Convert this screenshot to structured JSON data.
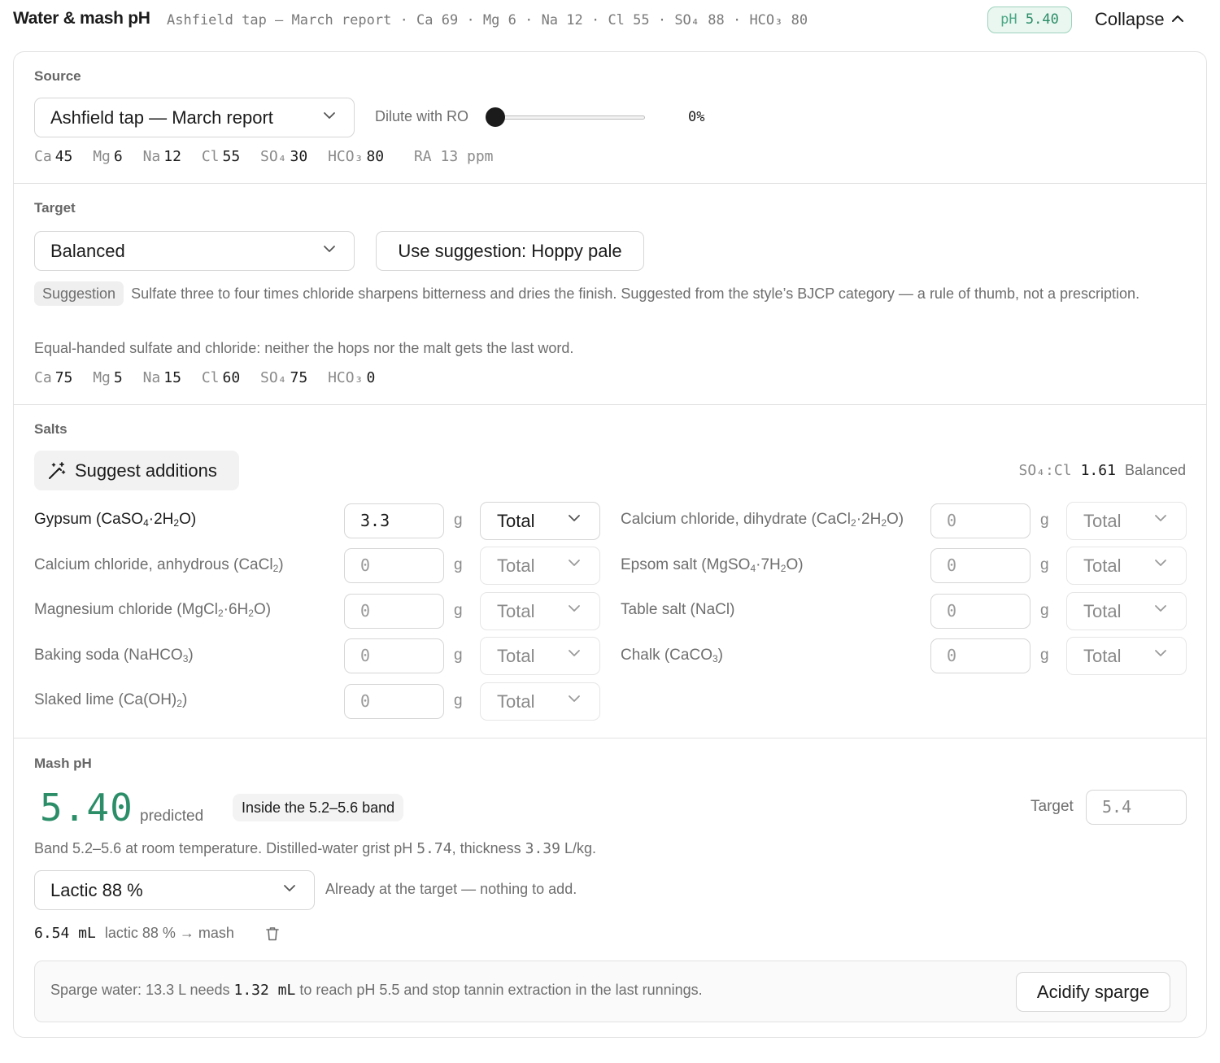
{
  "header": {
    "title": "Water & mash pH",
    "summary": "Ashfield tap — March report · Ca 69 · Mg 6 · Na 12 · Cl 55 · SO₄ 88 · HCO₃ 80",
    "ph_label": "pH",
    "ph_value": "5.40",
    "collapse_label": "Collapse"
  },
  "source": {
    "label": "Source",
    "profile": "Ashfield tap — March report",
    "dilute_label": "Dilute with RO",
    "dilute_value": "0%",
    "dilute_fraction": 0,
    "ions": [
      {
        "name": "Ca",
        "value": "45"
      },
      {
        "name": "Mg",
        "value": "6"
      },
      {
        "name": "Na",
        "value": "12"
      },
      {
        "name": "Cl",
        "value": "55"
      },
      {
        "name": "SO₄",
        "value": "30"
      },
      {
        "name": "HCO₃",
        "value": "80"
      }
    ],
    "ra": "RA 13 ppm"
  },
  "target": {
    "label": "Target",
    "profile": "Balanced",
    "suggestion_button": "Use suggestion: Hoppy pale",
    "suggestion_tag": "Suggestion",
    "suggestion_text": "Sulfate three to four times chloride sharpens bitterness and dries the finish. Suggested from the style’s BJCP category — a rule of thumb, not a prescription.",
    "description": "Equal-handed sulfate and chloride: neither the hops nor the malt gets the last word.",
    "ions": [
      {
        "name": "Ca",
        "value": "75"
      },
      {
        "name": "Mg",
        "value": "5"
      },
      {
        "name": "Na",
        "value": "15"
      },
      {
        "name": "Cl",
        "value": "60"
      },
      {
        "name": "SO₄",
        "value": "75"
      },
      {
        "name": "HCO₃",
        "value": "0"
      }
    ]
  },
  "salts": {
    "label": "Salts",
    "suggest_button": "Suggest additions",
    "ratio_label": "SO₄:Cl",
    "ratio_value": "1.61",
    "ratio_desc": "Balanced",
    "unit": "g",
    "items": [
      {
        "name": "Gypsum (CaSO₄·2H₂O)",
        "value": "3.3",
        "mode": "Total"
      },
      {
        "name": "Calcium chloride, dihydrate (CaCl₂·2H₂O)",
        "value": "0",
        "mode": "Total"
      },
      {
        "name": "Calcium chloride, anhydrous (CaCl₂)",
        "value": "0",
        "mode": "Total"
      },
      {
        "name": "Epsom salt (MgSO₄·7H₂O)",
        "value": "0",
        "mode": "Total"
      },
      {
        "name": "Magnesium chloride (MgCl₂·6H₂O)",
        "value": "0",
        "mode": "Total"
      },
      {
        "name": "Table salt (NaCl)",
        "value": "0",
        "mode": "Total"
      },
      {
        "name": "Baking soda (NaHCO₃)",
        "value": "0",
        "mode": "Total"
      },
      {
        "name": "Chalk (CaCO₃)",
        "value": "0",
        "mode": "Total"
      },
      {
        "name": "Slaked lime (Ca(OH)₂)",
        "value": "0",
        "mode": "Total"
      }
    ]
  },
  "mash": {
    "label": "Mash pH",
    "ph_value": "5.40",
    "predicted_label": "predicted",
    "band_badge": "Inside the 5.2–5.6 band",
    "target_label": "Target",
    "target_value": "5.4",
    "band_text_1": "Band 5.2–5.6 at room temperature. Distilled-water grist pH ",
    "grist_ph": "5.74",
    "band_text_2": ", thickness ",
    "thickness": "3.39",
    "band_text_3": " L/kg.",
    "acid": "Lactic 88 %",
    "acid_status": "Already at the target — nothing to add.",
    "addition_amount": "6.54 mL",
    "addition_desc": "lactic 88 % → mash",
    "sparge_text_1": "Sparge water: 13.3 L needs ",
    "sparge_amount": "1.32 mL",
    "sparge_text_2": " to reach pH 5.5 and stop tannin extraction in the last runnings.",
    "sparge_button": "Acidify sparge"
  },
  "colors": {
    "accent_green": "#2b8e69",
    "badge_bg": "#eaf6f0",
    "border": "#e2e2e2"
  }
}
